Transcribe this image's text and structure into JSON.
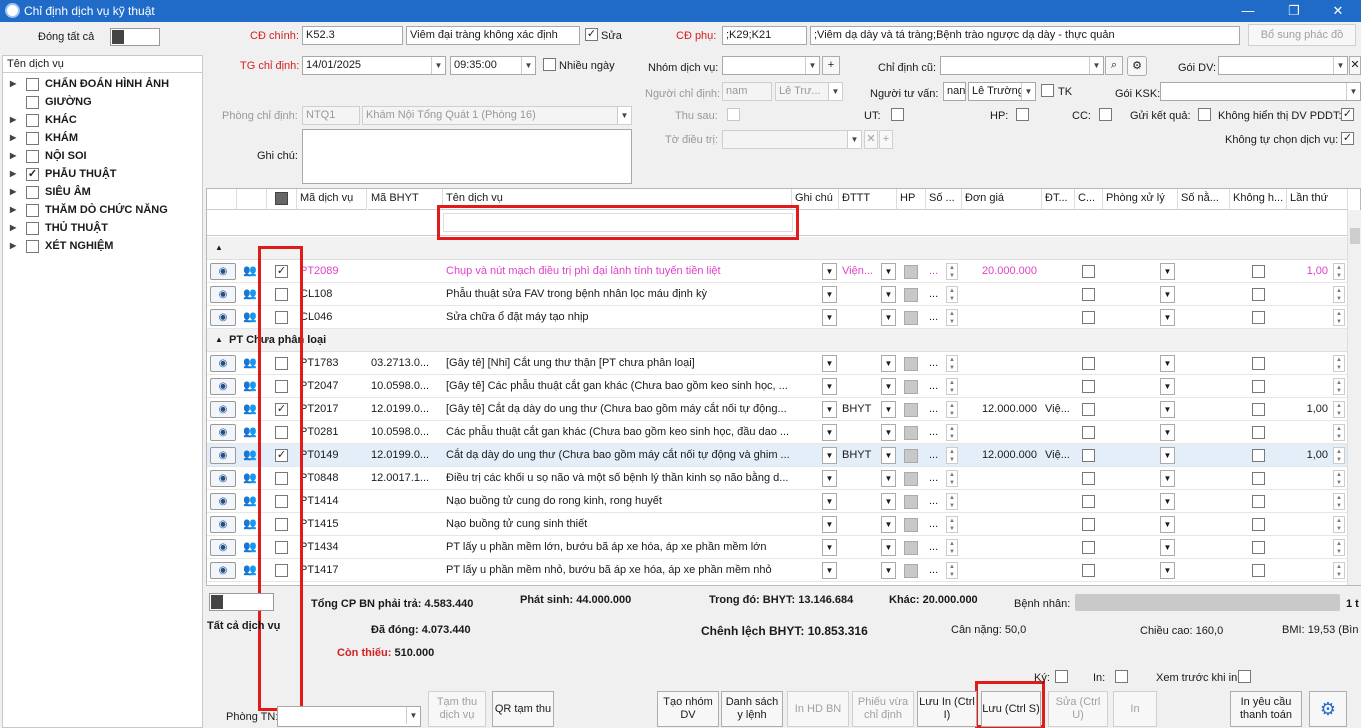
{
  "window": {
    "title": "Chỉ định dịch vụ kỹ thuật",
    "minimize": "—",
    "maximize": "❐",
    "close": "✕"
  },
  "left": {
    "collapse_all": "Đóng tất cả",
    "header": "Tên dịch vụ",
    "items": [
      {
        "label": "CHẨN ĐOÁN HÌNH ẢNH",
        "has_children": true,
        "checked": false
      },
      {
        "label": "GIƯỜNG",
        "has_children": false,
        "checked": false
      },
      {
        "label": "KHÁC",
        "has_children": true,
        "checked": false
      },
      {
        "label": "KHÁM",
        "has_children": true,
        "checked": false
      },
      {
        "label": "NỘI SOI",
        "has_children": true,
        "checked": false
      },
      {
        "label": "PHẪU THUẬT",
        "has_children": true,
        "checked": true
      },
      {
        "label": "SIÊU ÂM",
        "has_children": true,
        "checked": false
      },
      {
        "label": "THĂM DÒ CHỨC NĂNG",
        "has_children": true,
        "checked": false
      },
      {
        "label": "THỦ THUẬT",
        "has_children": true,
        "checked": false
      },
      {
        "label": "XÉT NGHIỆM",
        "has_children": true,
        "checked": false
      }
    ]
  },
  "form": {
    "cd_chinh_label": "CĐ chính:",
    "cd_chinh_code": "K52.3",
    "cd_chinh_name": "Viêm đại tràng không xác định",
    "sua_label": "Sửa",
    "sua_checked": true,
    "cd_phu_label": "CĐ phụ:",
    "cd_phu_code": ";K29;K21",
    "cd_phu_name": ";Viêm dạ dày và tá tràng;Bệnh trào ngược dạ dày - thực quản",
    "bo_sung_label": "Bổ sung phác đồ",
    "tg_label": "TG chỉ định:",
    "tg_date": "14/01/2025",
    "tg_time": "09:35:00",
    "nhieu_ngay_label": "Nhiều ngày",
    "nhom_dv_label": "Nhóm dịch vụ:",
    "chi_dinh_cu_label": "Chỉ định cũ:",
    "goi_dv_label": "Gói DV:",
    "nguoi_cd_label": "Người chỉ định:",
    "nguoi_cd_code": "nam",
    "nguoi_cd_name": "Lê Trư...",
    "nguoi_tv_label": "Người tư vấn:",
    "nguoi_tv_code": "nan",
    "nguoi_tv_name": "Lê Trường",
    "tk_label": "TK",
    "goi_ksk_label": "Gói KSK:",
    "phong_label": "Phòng chỉ định:",
    "phong_code": "NTQ1",
    "phong_name": "Khám Nội Tổng Quát 1 (Phòng 16)",
    "thu_sau_label": "Thu sau:",
    "ut_label": "UT:",
    "hp_label": "HP:",
    "cc_label": "CC:",
    "gui_kq_label": "Gửi kết quả:",
    "khong_hien_thi_label": "Không hiển thị DV PDDT:",
    "to_dieu_tri_label": "Tờ điều trị:",
    "khong_tu_chon_label": "Không tự chọn dịch vụ:",
    "ghi_chu_label": "Ghi chú:"
  },
  "grid": {
    "headers": [
      "Mã dịch vụ",
      "Mã BHYT",
      "Tên dịch vụ",
      "Ghi chú",
      "ĐTTT",
      "HP",
      "Số ...",
      "Đơn giá",
      "ĐT...",
      "C...",
      "Phòng xử lý",
      "Số nằ...",
      "Không h...",
      "Lần thứ"
    ],
    "rows": [
      {
        "type": "group",
        "label": ""
      },
      {
        "type": "row",
        "checked": true,
        "pink": true,
        "code": "PT2089",
        "bhyt": "",
        "name": "Chụp và nút mạch điều trị phì đại lành tính tuyến tiền liệt",
        "dttt": "Viện...",
        "dots": "...",
        "price": "20.000.000",
        "dt": "",
        "lan": "1,00"
      },
      {
        "type": "row",
        "checked": false,
        "code": "CL108",
        "bhyt": "",
        "name": "Phẫu thuật sửa FAV trong bệnh nhân lọc máu định kỳ",
        "dttt": "",
        "dots": "...",
        "price": "",
        "dt": "",
        "lan": ""
      },
      {
        "type": "row",
        "checked": false,
        "code": "CL046",
        "bhyt": "",
        "name": "Sửa chữa ổ đặt máy tạo nhịp",
        "dttt": "",
        "dots": "...",
        "price": "",
        "dt": "",
        "lan": ""
      },
      {
        "type": "group",
        "label": "PT Chưa phân loại"
      },
      {
        "type": "row",
        "checked": false,
        "code": "PT1783",
        "bhyt": "03.2713.0...",
        "name": "[Gây tê] [Nhi] Cắt ung thư thận [PT chưa phân loại]",
        "dttt": "",
        "dots": "...",
        "price": "",
        "dt": "",
        "lan": ""
      },
      {
        "type": "row",
        "checked": false,
        "code": "PT2047",
        "bhyt": "10.0598.0...",
        "name": "[Gây tê] Các phẫu thuật cắt gan khác (Chưa bao gồm keo sinh học, ...",
        "dttt": "",
        "dots": "...",
        "price": "",
        "dt": "",
        "lan": ""
      },
      {
        "type": "row",
        "checked": true,
        "code": "PT2017",
        "bhyt": "12.0199.0...",
        "name": "[Gây tê] Cắt dạ dày do ung thư (Chưa bao gồm máy cắt nối tự động...",
        "dttt": "BHYT",
        "dots": "...",
        "price": "12.000.000",
        "dt": "Việ...",
        "lan": "1,00"
      },
      {
        "type": "row",
        "checked": false,
        "code": "PT0281",
        "bhyt": "10.0598.0...",
        "name": "Các phẫu thuật cắt gan khác (Chưa bao gồm keo sinh học, đầu dao ...",
        "dttt": "",
        "dots": "...",
        "price": "",
        "dt": "",
        "lan": ""
      },
      {
        "type": "row",
        "checked": true,
        "selected": true,
        "code": "PT0149",
        "bhyt": "12.0199.0...",
        "name": "Cắt dạ dày do ung thư (Chưa bao gồm máy cắt nối tự động và ghim ...",
        "dttt": "BHYT",
        "dots": "...",
        "price": "12.000.000",
        "dt": "Việ...",
        "lan": "1,00"
      },
      {
        "type": "row",
        "checked": false,
        "code": "PT0848",
        "bhyt": "12.0017.1...",
        "name": "Điều trị các khối u sọ não và một số bệnh lý thần kinh sọ não bằng d...",
        "dttt": "",
        "dots": "...",
        "price": "",
        "dt": "",
        "lan": ""
      },
      {
        "type": "row",
        "checked": false,
        "code": "PT1414",
        "bhyt": "",
        "name": "Nạo buồng tử cung do rong kinh, rong huyết",
        "dttt": "",
        "dots": "...",
        "price": "",
        "dt": "",
        "lan": ""
      },
      {
        "type": "row",
        "checked": false,
        "code": "PT1415",
        "bhyt": "",
        "name": "Nạo buồng tử cung sinh thiết",
        "dttt": "",
        "dots": "...",
        "price": "",
        "dt": "",
        "lan": ""
      },
      {
        "type": "row",
        "checked": false,
        "code": "PT1434",
        "bhyt": "",
        "name": "PT lấy u phần mềm lớn, bướu bã áp xe hóa, áp xe phần mềm lớn",
        "dttt": "",
        "dots": "...",
        "price": "",
        "dt": "",
        "lan": ""
      },
      {
        "type": "row",
        "checked": false,
        "code": "PT1417",
        "bhyt": "",
        "name": "PT lấy u phần mềm nhỏ, bướu bã áp xe hóa, áp xe phần mềm nhỏ",
        "dttt": "",
        "dots": "...",
        "price": "",
        "dt": "",
        "lan": ""
      }
    ]
  },
  "summary": {
    "all_services_label": "Tất cả dịch vụ",
    "tong_cp_label": "Tổng CP BN phải trả:",
    "tong_cp": "4.583.440",
    "phat_sinh_label": "Phát sinh:",
    "phat_sinh": "44.000.000",
    "trong_do_label": "Trong đó: BHYT:",
    "trong_do": "13.146.684",
    "khac_label": "Khác:",
    "khac": "20.000.000",
    "benh_nhan_label": "Bệnh nhân:",
    "benh_nhan_suffix": "1 t",
    "da_dong_label": "Đã đóng:",
    "da_dong": "4.073.440",
    "chenh_lech_label": "Chênh lệch BHYT:",
    "chenh_lech": "10.853.316",
    "can_nang_label": "Cân nặng:",
    "can_nang": "50,0",
    "chieu_cao_label": "Chiều cao:",
    "chieu_cao": "160,0",
    "bmi_label": "BMI:",
    "bmi": "19,53",
    "bmi_suffix": "(Bìn",
    "con_thieu_label": "Còn thiếu:",
    "con_thieu": "510.000",
    "ky_label": "Ký:",
    "in_label": "In:",
    "xem_truoc_label": "Xem trước khi in",
    "phong_tn_label": "Phòng TN:"
  },
  "buttons": {
    "tam_thu_dv": "Tạm thu dịch vụ",
    "qr_tam_thu": "QR tạm thu",
    "tao_nhom_dv": "Tạo nhóm DV",
    "danh_sach_y_lenh": "Danh sách y lệnh",
    "in_hd_bn": "In HD BN",
    "phieu_vua_cd": "Phiếu vừa chỉ định",
    "luu_in": "Lưu In (Ctrl I)",
    "luu": "Lưu (Ctrl S)",
    "sua": "Sửa (Ctrl U)",
    "in": "In",
    "in_yeu_cau_tt": "In yêu cầu thanh toán"
  },
  "colors": {
    "accent": "#1f6bc7",
    "highlight_red": "#e11b1b",
    "pink_text": "#e040c8",
    "selected_row": "#e4eef9"
  }
}
